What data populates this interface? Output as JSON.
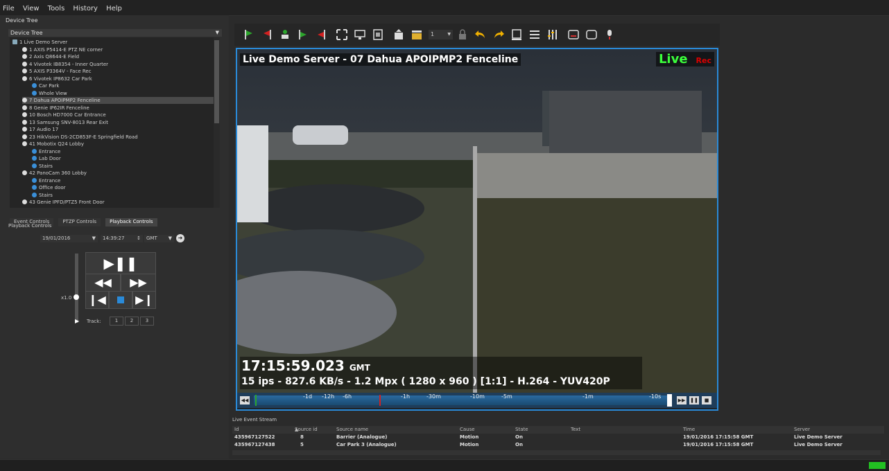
{
  "menu": [
    "File",
    "View",
    "Tools",
    "History",
    "Help"
  ],
  "device_tree": {
    "panel_title": "Device Tree",
    "combo_value": "Device Tree",
    "items": [
      {
        "label": "1 Live Demo Server",
        "indent": 0,
        "icon": "server-icon"
      },
      {
        "label": "1 AXIS P5414-E PTZ NE corner",
        "indent": 1,
        "icon": "camera-icon"
      },
      {
        "label": "2 Axis Q8644-E Field",
        "indent": 1,
        "icon": "camera-icon"
      },
      {
        "label": "4 Vivotek IB8354 - Inner Quarter",
        "indent": 1,
        "icon": "camera-icon"
      },
      {
        "label": "5 AXIS P3364V - Face Rec",
        "indent": 1,
        "icon": "camera-icon"
      },
      {
        "label": "6 Vivotek IP8632 Car Park",
        "indent": 1,
        "icon": "camera-icon"
      },
      {
        "label": "Car Park",
        "indent": 2,
        "icon": "view-icon"
      },
      {
        "label": "Whole View",
        "indent": 2,
        "icon": "view-icon"
      },
      {
        "label": "7 Dahua APOIPMP2 Fenceline",
        "indent": 1,
        "icon": "camera-icon",
        "selected": true
      },
      {
        "label": "8 Genie IP62IR Fenceline",
        "indent": 1,
        "icon": "camera-icon"
      },
      {
        "label": "10 Bosch HD7000 Car Entrance",
        "indent": 1,
        "icon": "camera-icon"
      },
      {
        "label": "13 Samsung SNV-8013 Rear Exit",
        "indent": 1,
        "icon": "camera-icon"
      },
      {
        "label": "17 Audio 17",
        "indent": 1,
        "icon": "audio-icon"
      },
      {
        "label": "23 HikVision DS-2CD853F-E Springfield Road",
        "indent": 1,
        "icon": "camera-icon"
      },
      {
        "label": "41 Mobotix Q24 Lobby",
        "indent": 1,
        "icon": "camera-icon"
      },
      {
        "label": "Entrance",
        "indent": 2,
        "icon": "view-icon"
      },
      {
        "label": "Lab Door",
        "indent": 2,
        "icon": "view-icon"
      },
      {
        "label": "Stairs",
        "indent": 2,
        "icon": "view-icon"
      },
      {
        "label": "42 PanoCam 360 Lobby",
        "indent": 1,
        "icon": "camera-icon"
      },
      {
        "label": "Entrance",
        "indent": 2,
        "icon": "view-icon"
      },
      {
        "label": "Office door",
        "indent": 2,
        "icon": "view-icon"
      },
      {
        "label": "Stairs",
        "indent": 2,
        "icon": "view-icon"
      },
      {
        "label": "43 Genie IPFD/PTZ5 Front Door",
        "indent": 1,
        "icon": "camera-icon"
      }
    ]
  },
  "tabs": [
    "Event Controls",
    "PTZP Controls",
    "Playback Controls"
  ],
  "playback": {
    "title": "Playback Controls",
    "date": "19/01/2016",
    "time": "14:39:27",
    "timezone": "GMT",
    "speed": "x1.0",
    "track_label": "Track:",
    "tracks": [
      "1",
      "2",
      "3"
    ]
  },
  "toolbar": {
    "page_number": "1"
  },
  "viewer": {
    "camera_title": "Live Demo Server - 07 Dahua APOIPMP2 Fenceline",
    "live_label": "Live",
    "rec_label": "Rec",
    "time": "17:15:59.023",
    "timezone": "GMT",
    "stats": "15 ips  -  827.6 KB/s  -  1.2 Mpx  ( 1280 x 960 ) [1:1]  -  H.264  -  YUV420P",
    "timeline_labels": [
      "-1d",
      "-12h",
      "-6h",
      "-1h",
      "-30m",
      "-10m",
      "-5m",
      "-1m",
      "-10s"
    ]
  },
  "event_stream": {
    "title": "Live Event Stream",
    "columns": [
      "Id",
      "Source id",
      "Source name",
      "Cause",
      "State",
      "Text",
      "Time",
      "Server"
    ],
    "rows": [
      [
        "435967127522",
        "8",
        "Barrier (Analogue)",
        "Motion",
        "On",
        "",
        "19/01/2016 17:15:58 GMT",
        "Live Demo Server"
      ],
      [
        "435967127438",
        "5",
        "Car Park 3 (Analogue)",
        "Motion",
        "On",
        "",
        "19/01/2016 17:15:58 GMT",
        "Live Demo Server"
      ]
    ]
  },
  "colors": {
    "accent": "#2a8ad8",
    "live": "#3cff3c",
    "rec": "#dd0000",
    "status_ok": "#22c022"
  }
}
